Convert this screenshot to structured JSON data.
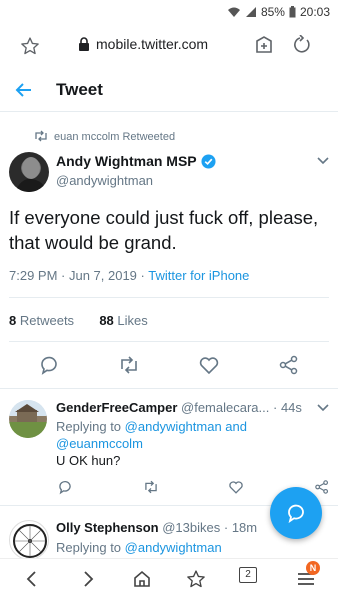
{
  "status_bar": {
    "battery": "85%",
    "time": "20:03"
  },
  "browser": {
    "url": "mobile.twitter.com"
  },
  "header": {
    "title": "Tweet"
  },
  "main_tweet": {
    "retweeted_by": "euan mccolm Retweeted",
    "author_name": "Andy Wightman MSP",
    "author_handle": "@andywightman",
    "text": "If everyone could just fuck off, please, that would be grand.",
    "time": "7:29 PM · Jun 7, 2019 · ",
    "source": "Twitter for iPhone",
    "retweets_count": "8",
    "retweets_label": "Retweets",
    "likes_count": "88",
    "likes_label": "Likes"
  },
  "replies": [
    {
      "author_name": "GenderFreeCamper",
      "author_handle": "@femalecara...",
      "time": "44s",
      "replying_prefix": "Replying to ",
      "replying_to_1": "@andywightman",
      "replying_and": " and",
      "replying_to_2": "@euanmccolm",
      "text": "U OK hun?"
    },
    {
      "author_name": "Olly Stephenson",
      "author_handle": "@13bikes",
      "time": "18m",
      "replying_prefix": "Replying to ",
      "replying_to_1": "@andywightman"
    }
  ],
  "bottom_nav": {
    "tab_count": "2",
    "menu_badge": "N"
  },
  "colors": {
    "accent": "#1da1f2",
    "link": "#1b95e0",
    "muted": "#657786",
    "badge": "#f26722"
  }
}
